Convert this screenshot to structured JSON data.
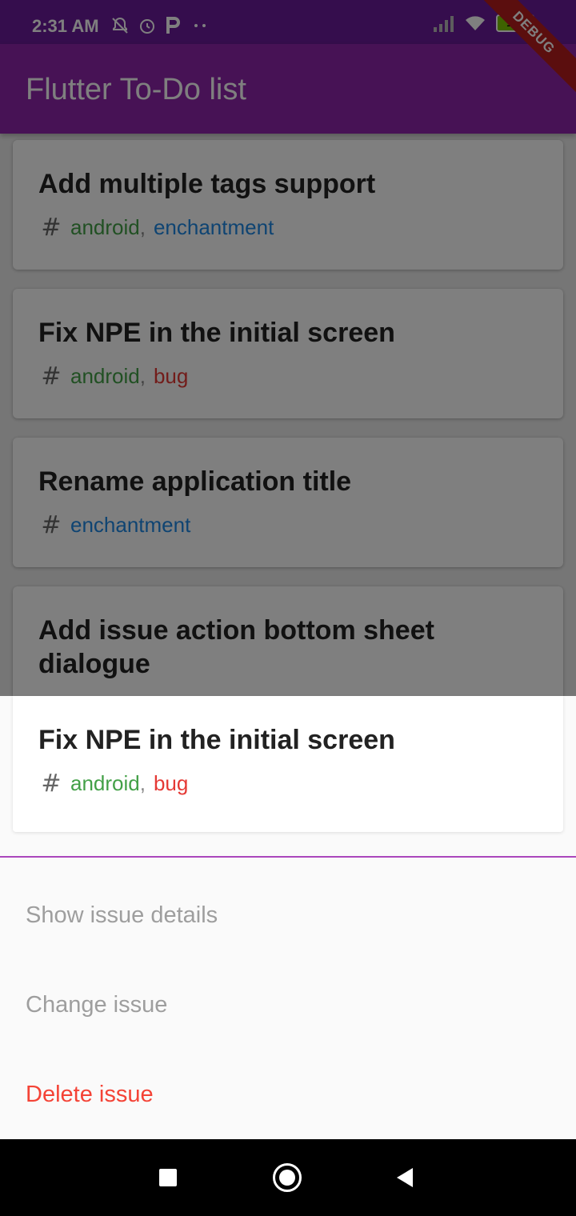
{
  "status_bar": {
    "time": "2:31 AM",
    "left_icons": [
      "notifications-off-icon",
      "alarm-icon",
      "parking-icon",
      "more-dots-icon"
    ],
    "right_icons": [
      "signal-icon",
      "wifi-icon",
      "battery-icon"
    ],
    "battery_level": "100"
  },
  "app_bar": {
    "title": "Flutter To-Do list"
  },
  "debug_banner": "DEBUG",
  "issues": [
    {
      "title": "Add multiple tags support",
      "tags": [
        "android",
        "enchantment"
      ]
    },
    {
      "title": "Fix NPE in the initial screen",
      "tags": [
        "android",
        "bug"
      ]
    },
    {
      "title": "Rename application title",
      "tags": [
        "enchantment"
      ]
    },
    {
      "title": "Add issue action bottom sheet dialogue",
      "tags": []
    }
  ],
  "sheet": {
    "selected_issue": {
      "title": "Fix NPE in the initial screen",
      "tags": [
        "android",
        "bug"
      ]
    },
    "actions": {
      "show_details": "Show issue details",
      "change": "Change issue",
      "delete": "Delete issue"
    }
  },
  "tag_separator": ",",
  "colors": {
    "primary": "#8e24aa",
    "primary_dark": "#6a1b9a",
    "tag_android": "#43a047",
    "tag_enchantment": "#1e88e5",
    "tag_bug": "#e53935",
    "delete": "#f44336"
  }
}
